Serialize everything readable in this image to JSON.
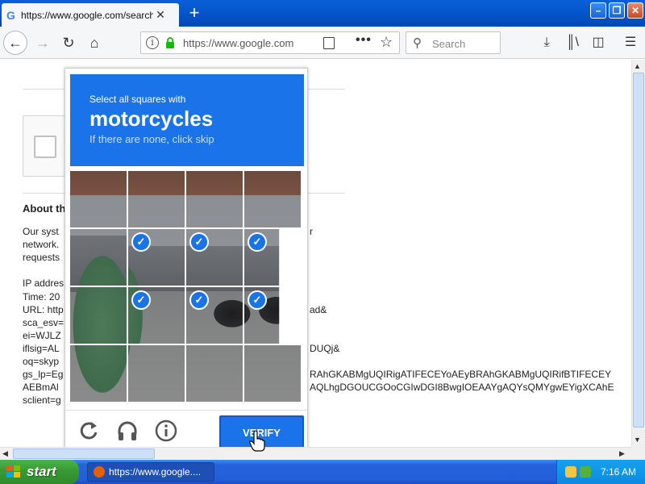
{
  "browser": {
    "tab_title": "https://www.google.com/search?...",
    "tab_favicon": "G",
    "url_display": "https://www.google.com",
    "search_placeholder": "Search"
  },
  "page": {
    "about_heading": "About th",
    "lines": [
      "Our syst",
      "network.",
      "requests",
      "",
      "IP addres",
      "Time: 20",
      "URL: http",
      "sca_esv=",
      "ei=WJLZ",
      "iflsig=AL",
      "oq=skyp",
      "gs_lp=Eg",
      "AEBmAl",
      "sclient=g"
    ],
    "right_fragments": [
      {
        "text": "r",
        "row": 0
      },
      {
        "text": "ad&",
        "row": 6
      },
      {
        "text": "DUQj&",
        "row": 9
      },
      {
        "text": "RAhGKABMgUQIRigATIFECEYoAEyBRAhGKABMgUQIRifBTIFECEY",
        "row": 11
      },
      {
        "text": "AQLhgDGOUCGOoCGIwDGI8BwgIOEAAYgAQYsQMYgwEYigXCAhE",
        "row": 12
      }
    ]
  },
  "captcha": {
    "instruction": "Select all squares with",
    "target": "motorcycles",
    "hint": "If there are none, click skip",
    "verify_label": "VERIFY",
    "selected_tiles": [
      5,
      6,
      7,
      9,
      10,
      11
    ],
    "icons": [
      "reload-icon",
      "audio-headphones-icon",
      "info-icon"
    ]
  },
  "taskbar": {
    "start_label": "start",
    "task_label": "https://www.google....",
    "clock": "7:16 AM"
  },
  "colors": {
    "captcha_blue": "#1a73e8",
    "xp_blue": "#245edb",
    "start_green": "#3a9c35"
  }
}
